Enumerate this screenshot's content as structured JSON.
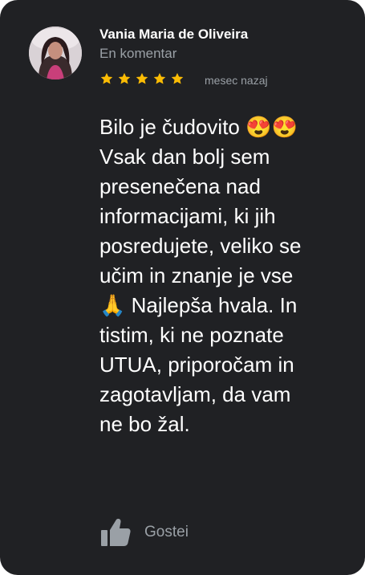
{
  "review": {
    "author": "Vania Maria de Oliveira",
    "subtitle": "En komentar",
    "rating": 5,
    "max_rating": 5,
    "time_ago": "mesec nazaj",
    "text": "Bilo je čudovito 😍😍\nVsak dan bolj sem\npresenečena nad\ninformacijami, ki jih\nposredujete, veliko se\nučim in znanje je vse\n🙏 Najlepša hvala. In\ntistim, ki ne poznate\nUTUA, priporočam in\nzagotavljam, da vam\nne bo žal.",
    "like_label": "Gostei"
  },
  "colors": {
    "card_background": "#202124",
    "star": "#fbbc04",
    "muted_text": "#9aa0a6",
    "primary_text": "#ffffff"
  },
  "icons": {
    "avatar": "profile-photo",
    "like": "thumbs-up-icon",
    "rating": "star-icon"
  }
}
